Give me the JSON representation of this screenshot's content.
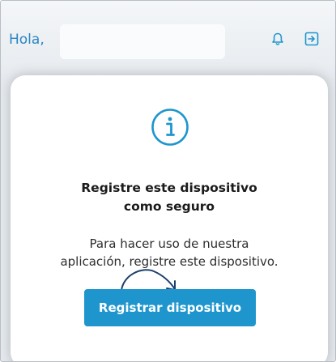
{
  "header": {
    "greeting": "Hola,",
    "user_name": "",
    "icons": [
      "bell-icon",
      "logout-icon"
    ]
  },
  "modal": {
    "icon": "info-icon",
    "title_line1": "Registre este dispositivo",
    "title_line2": "como seguro",
    "message_line1": "Para hacer uso de nuestra",
    "message_line2": "aplicación, registre este dispositivo.",
    "button_label": "Registrar dispositivo"
  },
  "colors": {
    "accent": "#1e96cd",
    "header_text": "#2a86c4",
    "background": "#e6eaee"
  }
}
